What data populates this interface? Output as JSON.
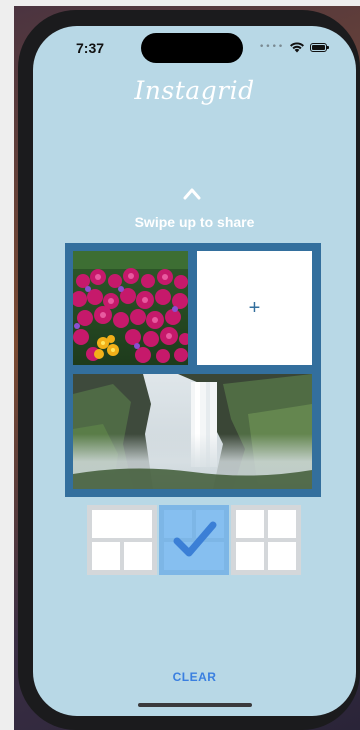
{
  "status_bar": {
    "time": "7:37"
  },
  "app": {
    "title": "Instagrid"
  },
  "share": {
    "hint": "Swipe up to share"
  },
  "grid": {
    "frame_color": "#336f9d",
    "empty_slot_symbol": "+"
  },
  "layouts": {
    "options": [
      "one-top-two-bottom",
      "two-top-one-bottom",
      "two-by-two"
    ],
    "selected_index": 1,
    "selected_color": "#7db6e6"
  },
  "actions": {
    "clear_label": "CLEAR",
    "clear_color": "#3a7fe0"
  },
  "colors": {
    "background": "#b8d8e6"
  },
  "icons": [
    "chevron-up-icon",
    "wifi-icon",
    "battery-icon",
    "checkmark-icon",
    "plus-icon"
  ]
}
